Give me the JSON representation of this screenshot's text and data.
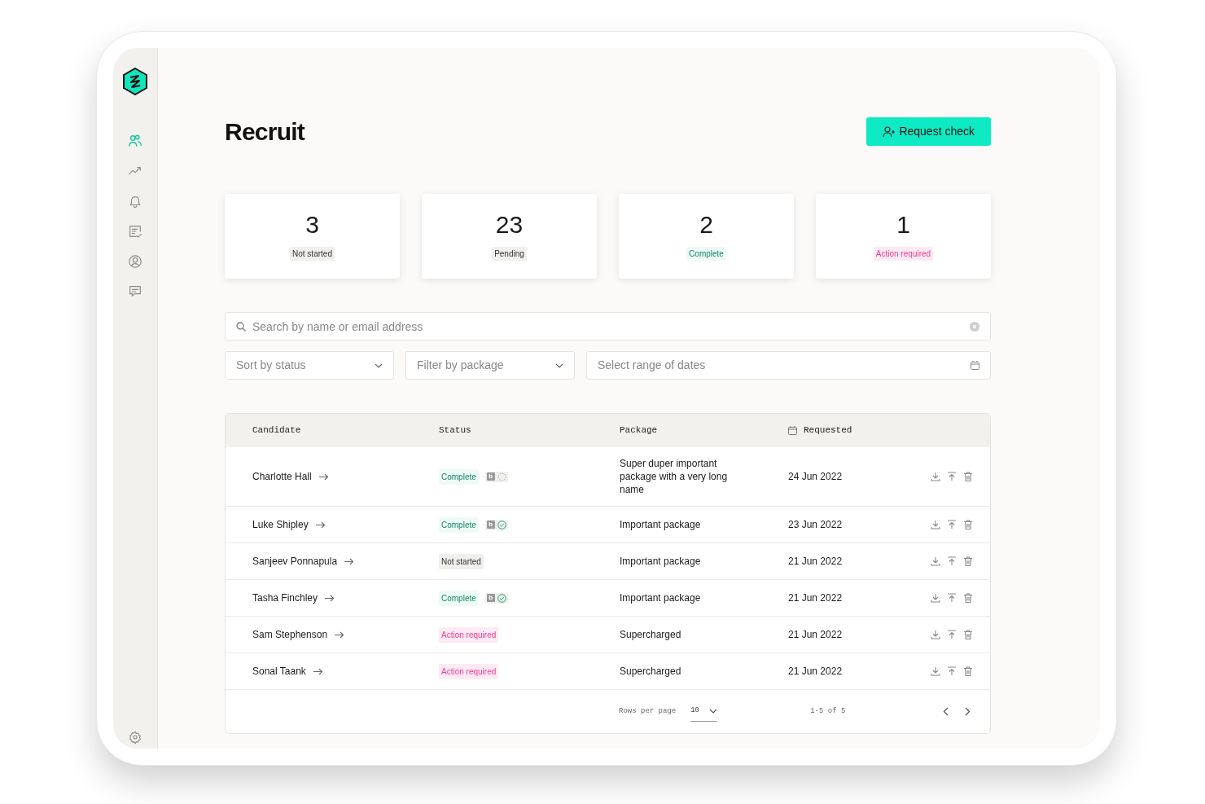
{
  "sidebar": {
    "items": [
      {
        "selected": true
      },
      {
        "selected": false
      },
      {
        "selected": false
      },
      {
        "selected": false
      },
      {
        "selected": false
      },
      {
        "selected": false
      }
    ]
  },
  "page": {
    "title": "Recruit",
    "primary_button": "Request check"
  },
  "stats": [
    {
      "value": "3",
      "label": "Not started",
      "kind": "not_started"
    },
    {
      "value": "23",
      "label": "Pending",
      "kind": "pending"
    },
    {
      "value": "2",
      "label": "Complete",
      "kind": "complete"
    },
    {
      "value": "1",
      "label": "Action required",
      "kind": "action"
    }
  ],
  "search": {
    "placeholder": "Search by name or email address"
  },
  "filters": [
    {
      "placeholder": "Sort by status",
      "kind": "select"
    },
    {
      "placeholder": "Filter by package",
      "kind": "select"
    },
    {
      "placeholder": "Select range of dates",
      "kind": "date"
    }
  ],
  "table": {
    "columns": [
      "Candidate",
      "Status",
      "Package",
      "Requested"
    ],
    "rows": [
      {
        "candidate": "Charlotte Hall",
        "status": "Complete",
        "kind": "complete",
        "check_badge": "b",
        "verified": false,
        "package": "Super duper important package with a very long name",
        "requested": "24 Jun 2022"
      },
      {
        "candidate": "Luke Shipley",
        "status": "Complete",
        "kind": "complete",
        "check_badge": "b",
        "verified": true,
        "package": "Important package",
        "requested": "23 Jun 2022"
      },
      {
        "candidate": "Sanjeev Ponnapula",
        "status": "Not started",
        "kind": "not_started",
        "package": "Important package",
        "requested": "21 Jun 2022"
      },
      {
        "candidate": "Tasha Finchley",
        "status": "Complete",
        "kind": "complete",
        "check_badge": "b",
        "verified": true,
        "package": "Important package",
        "requested": "21 Jun 2022"
      },
      {
        "candidate": "Sam Stephenson",
        "status": "Action required",
        "kind": "action",
        "package": "Supercharged",
        "requested": "21 Jun 2022"
      },
      {
        "candidate": "Sonal Taank",
        "status": "Action required",
        "kind": "action",
        "package": "Supercharged",
        "requested": "21 Jun 2022"
      }
    ]
  },
  "pagination": {
    "rows_per_page_label": "Rows per page",
    "rows_per_page": "10",
    "range": "1-5 of 5"
  }
}
